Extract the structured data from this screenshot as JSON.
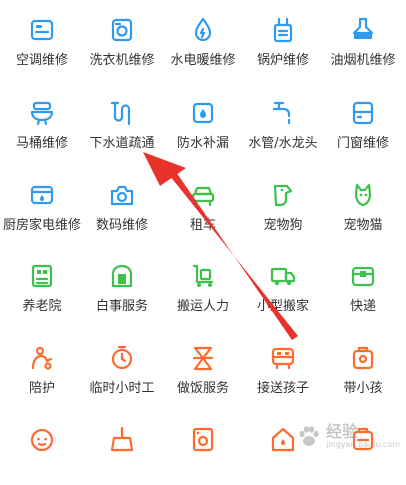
{
  "colors": {
    "blue": "#2f9bf0",
    "green": "#3cc24a",
    "orange": "#ff6a2e",
    "arrow": "#e8322a",
    "label": "#333333"
  },
  "services": [
    {
      "label": "空调维修",
      "icon": "air-conditioner-icon",
      "color": "blue"
    },
    {
      "label": "洗衣机维修",
      "icon": "washing-machine-icon",
      "color": "blue"
    },
    {
      "label": "水电暖维修",
      "icon": "water-drop-icon",
      "color": "blue"
    },
    {
      "label": "锅炉维修",
      "icon": "boiler-icon",
      "color": "blue"
    },
    {
      "label": "油烟机维修",
      "icon": "range-hood-icon",
      "color": "blue"
    },
    {
      "label": "马桶维修",
      "icon": "toilet-icon",
      "color": "blue"
    },
    {
      "label": "下水道疏通",
      "icon": "drain-pipe-icon",
      "color": "blue"
    },
    {
      "label": "防水补漏",
      "icon": "waterproof-icon",
      "color": "blue"
    },
    {
      "label": "水管/水龙头",
      "icon": "faucet-icon",
      "color": "blue"
    },
    {
      "label": "门窗维修",
      "icon": "window-icon",
      "color": "blue"
    },
    {
      "label": "厨房家电维修",
      "icon": "microwave-icon",
      "color": "blue"
    },
    {
      "label": "数码维修",
      "icon": "camera-icon",
      "color": "blue"
    },
    {
      "label": "租车",
      "icon": "car-icon",
      "color": "green"
    },
    {
      "label": "宠物狗",
      "icon": "dog-icon",
      "color": "green"
    },
    {
      "label": "宠物猫",
      "icon": "cat-icon",
      "color": "green"
    },
    {
      "label": "养老院",
      "icon": "nursing-home-icon",
      "color": "green"
    },
    {
      "label": "白事服务",
      "icon": "funeral-icon",
      "color": "green"
    },
    {
      "label": "搬运人力",
      "icon": "moving-cart-icon",
      "color": "green"
    },
    {
      "label": "小型搬家",
      "icon": "truck-icon",
      "color": "green"
    },
    {
      "label": "快递",
      "icon": "package-icon",
      "color": "green"
    },
    {
      "label": "陪护",
      "icon": "caregiver-icon",
      "color": "orange"
    },
    {
      "label": "临时小时工",
      "icon": "stopwatch-icon",
      "color": "orange"
    },
    {
      "label": "做饭服务",
      "icon": "cooking-icon",
      "color": "orange"
    },
    {
      "label": "接送孩子",
      "icon": "school-bus-icon",
      "color": "orange"
    },
    {
      "label": "带小孩",
      "icon": "baby-icon",
      "color": "orange"
    },
    {
      "label": "",
      "icon": "child-face-icon",
      "color": "orange"
    },
    {
      "label": "",
      "icon": "cleaning-icon",
      "color": "orange"
    },
    {
      "label": "",
      "icon": "appliance-cleaning-icon",
      "color": "orange"
    },
    {
      "label": "",
      "icon": "house-icon",
      "color": "orange"
    },
    {
      "label": "",
      "icon": "tutor-icon",
      "color": "orange"
    }
  ],
  "watermark": {
    "title": "经验",
    "subtitle": "jingyan.baidu.com"
  }
}
